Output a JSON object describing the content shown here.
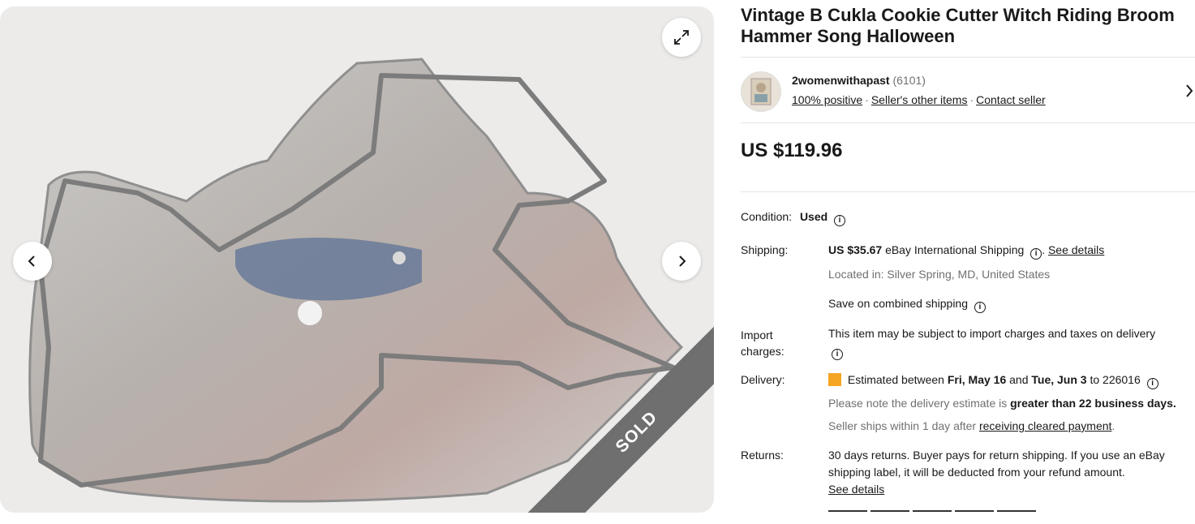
{
  "listing": {
    "title": "Vintage B Cukla Cookie Cutter Witch Riding Broom Hammer Song Halloween",
    "sold_label": "SOLD"
  },
  "seller": {
    "name": "2womenwithapast",
    "feedback_count": "(6101)",
    "positive": "100% positive",
    "other_items": "Seller's other items",
    "contact": "Contact seller",
    "separator": "·"
  },
  "price": "US $119.96",
  "condition": {
    "label": "Condition:",
    "value": "Used"
  },
  "shipping": {
    "label": "Shipping:",
    "amount": "US $35.67",
    "method": "eBay International Shipping",
    "see_details": "See details",
    "period": ".",
    "located": "Located in: Silver Spring, MD, United States",
    "combined": "Save on combined shipping"
  },
  "import": {
    "label_line1": "Import",
    "label_line2": "charges:",
    "text": "This item may be subject to import charges and taxes on delivery"
  },
  "delivery": {
    "label": "Delivery:",
    "est_prefix": "Estimated between",
    "date1": "Fri, May 16",
    "and": "and",
    "date2": "Tue, Jun 3",
    "to": "to 226016",
    "note_prefix": "Please note the delivery estimate is",
    "note_bold": "greater than 22 business days.",
    "ships_prefix": "Seller ships within 1 day after",
    "ships_link": "receiving cleared payment",
    "ships_suffix": "."
  },
  "returns": {
    "label": "Returns:",
    "text": "30 days returns. Buyer pays for return shipping. If you use an eBay shipping label, it will be deducted from your refund amount.",
    "see_details": "See details"
  },
  "icons": {
    "expand": "expand-icon",
    "prev": "chevron-left-icon",
    "next": "chevron-right-icon",
    "info": "info-icon",
    "flag": "delivery-flag-icon"
  }
}
